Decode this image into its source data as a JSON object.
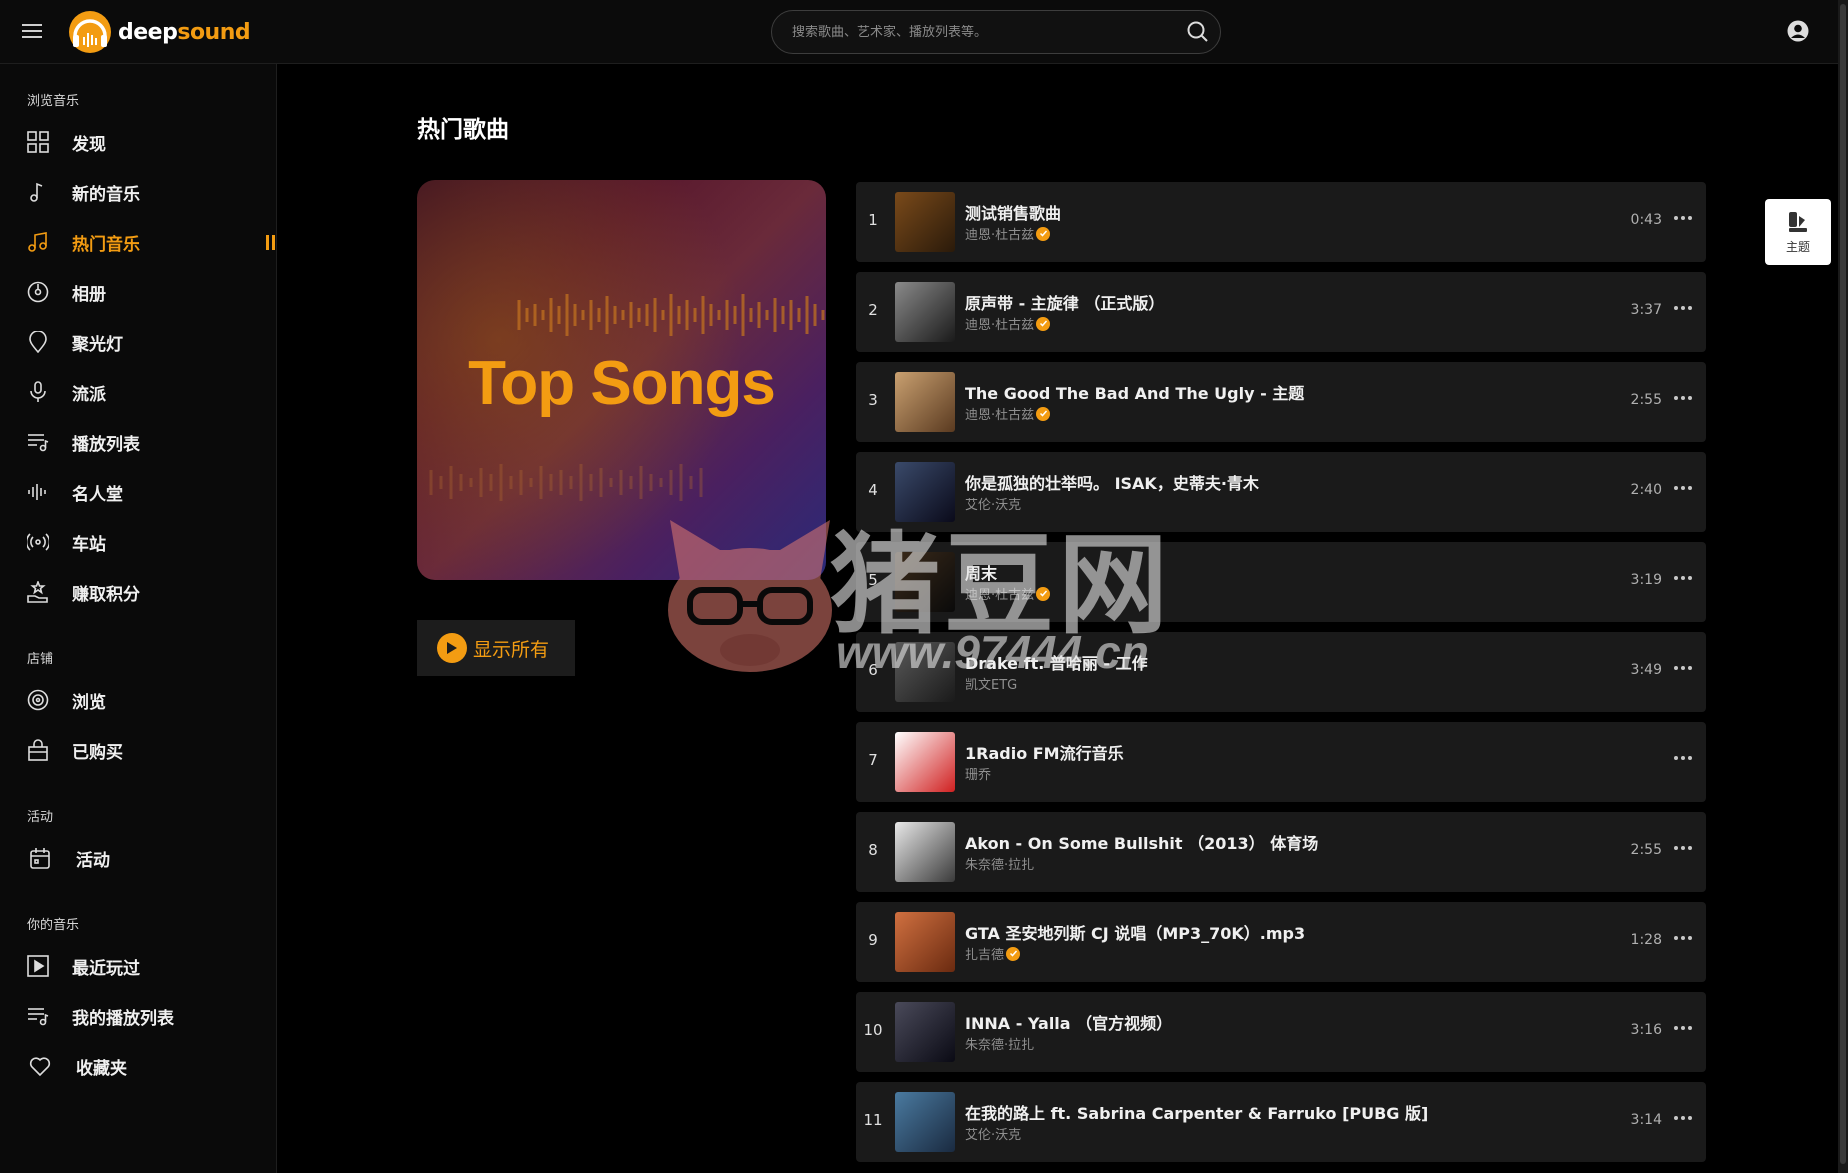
{
  "header": {
    "logo_text_a": "deep",
    "logo_text_b": "sound",
    "search_placeholder": "搜索歌曲、艺术家、播放列表等。"
  },
  "sidebar": {
    "sections": [
      {
        "title": "浏览音乐"
      },
      {
        "title": "店铺"
      },
      {
        "title": "活动"
      },
      {
        "title": "你的音乐"
      }
    ],
    "items": [
      {
        "label": "发现",
        "icon": "grid-icon"
      },
      {
        "label": "新的音乐",
        "icon": "music-note-icon"
      },
      {
        "label": "热门音乐",
        "icon": "music-notes-icon",
        "active": true
      },
      {
        "label": "相册",
        "icon": "disc-icon"
      },
      {
        "label": "聚光灯",
        "icon": "spotlight-icon"
      },
      {
        "label": "流派",
        "icon": "microphone-icon"
      },
      {
        "label": "播放列表",
        "icon": "playlist-icon"
      },
      {
        "label": "名人堂",
        "icon": "waveform-icon"
      },
      {
        "label": "车站",
        "icon": "radio-icon"
      },
      {
        "label": "赚取积分",
        "icon": "points-icon"
      },
      {
        "label": "浏览",
        "icon": "browse-icon"
      },
      {
        "label": "已购买",
        "icon": "bag-icon"
      },
      {
        "label": "活动",
        "icon": "calendar-icon"
      },
      {
        "label": "最近玩过",
        "icon": "play-square-icon"
      },
      {
        "label": "我的播放列表",
        "icon": "playlist-icon"
      },
      {
        "label": "收藏夹",
        "icon": "heart-icon"
      }
    ]
  },
  "main": {
    "page_title": "热门歌曲",
    "cover_title": "Top Songs",
    "show_all_label": "显示所有",
    "theme_label": "主题"
  },
  "songs": [
    {
      "num": "1",
      "title": "测试销售歌曲",
      "artist": "迪恩·杜古兹",
      "verified": true,
      "duration": "0:43",
      "thumb": [
        "#7a4a1a",
        "#2a1a0a"
      ]
    },
    {
      "num": "2",
      "title": "原声带 - 主旋律 （正式版）",
      "artist": "迪恩·杜古兹",
      "verified": true,
      "duration": "3:37",
      "thumb": [
        "#8a8a8a",
        "#1a1a1a"
      ]
    },
    {
      "num": "3",
      "title": "The Good The Bad And The Ugly - 主题",
      "artist": "迪恩·杜古兹",
      "verified": true,
      "duration": "2:55",
      "thumb": [
        "#c9a070",
        "#5a3a20"
      ]
    },
    {
      "num": "4",
      "title": "你是孤独的壮举吗。 ISAK，史蒂夫·青木",
      "artist": "艾伦·沃克",
      "verified": false,
      "duration": "2:40",
      "thumb": [
        "#3a4a6a",
        "#0a0a1a"
      ]
    },
    {
      "num": "5",
      "title": "周末",
      "artist": "迪恩·杜古兹",
      "verified": true,
      "duration": "3:19",
      "thumb": [
        "#3a2a1a",
        "#0a0a0a"
      ]
    },
    {
      "num": "6",
      "title": "Drake ft. 普哈丽 - 工作",
      "artist": "凯文ETG",
      "verified": false,
      "duration": "3:49",
      "thumb": [
        "#5a5a5a",
        "#1a1a1a"
      ]
    },
    {
      "num": "7",
      "title": "1Radio FM流行音乐",
      "artist": "珊乔",
      "verified": false,
      "duration": "",
      "thumb": [
        "#ffffff",
        "#d02020"
      ]
    },
    {
      "num": "8",
      "title": "Akon - On Some Bullshit （2013） 体育场",
      "artist": "朱奈德·拉扎",
      "verified": false,
      "duration": "2:55",
      "thumb": [
        "#e8e8e8",
        "#3a3a3a"
      ]
    },
    {
      "num": "9",
      "title": "GTA 圣安地列斯 CJ 说唱（MP3_70K）.mp3",
      "artist": "扎吉德",
      "verified": true,
      "duration": "1:28",
      "thumb": [
        "#d07040",
        "#6a2a10"
      ]
    },
    {
      "num": "10",
      "title": "INNA - Yalla （官方视频）",
      "artist": "朱奈德·拉扎",
      "verified": false,
      "duration": "3:16",
      "thumb": [
        "#4a4a5a",
        "#0a0a14"
      ]
    },
    {
      "num": "11",
      "title": "在我的路上 ft. Sabrina Carpenter & Farruko [PUBG 版]",
      "artist": "艾伦·沃克",
      "verified": false,
      "duration": "3:14",
      "thumb": [
        "#4a7aa0",
        "#1a2a40"
      ]
    }
  ],
  "watermark": {
    "text": "猪豆网",
    "url": "www.97444.cn"
  },
  "colors": {
    "accent": "#f39c12",
    "background": "#000000",
    "row": "#1a1a1a"
  }
}
